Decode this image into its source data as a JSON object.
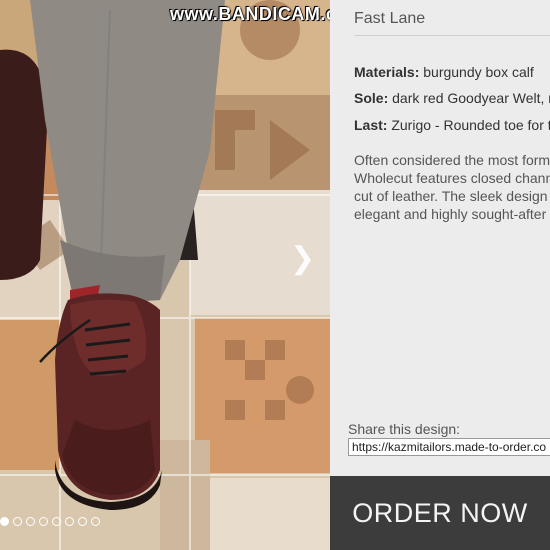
{
  "watermark": "www.BANDICAM.com",
  "gallery": {
    "next_icon": "chevron-right-icon",
    "dots": [
      true,
      false,
      false,
      false,
      false,
      false,
      false,
      false
    ]
  },
  "product": {
    "title": "Fast Lane",
    "materials_label": "Materials:",
    "materials_value": " burgundy box calf",
    "sole_label": "Sole:",
    "sole_value": " dark red Goodyear Welt, m",
    "last_label": "Last:",
    "last_value": " Zurigo - Rounded toe for tr",
    "description_lines": [
      "Often considered the most form",
      "Wholecut features closed chann",
      "cut of leather. The sleek design a",
      "elegant and highly sought-after s"
    ]
  },
  "share": {
    "label": "Share this design:",
    "url": "https://kazmitailors.made-to-order.co"
  },
  "order_button": "ORDER NOW"
}
